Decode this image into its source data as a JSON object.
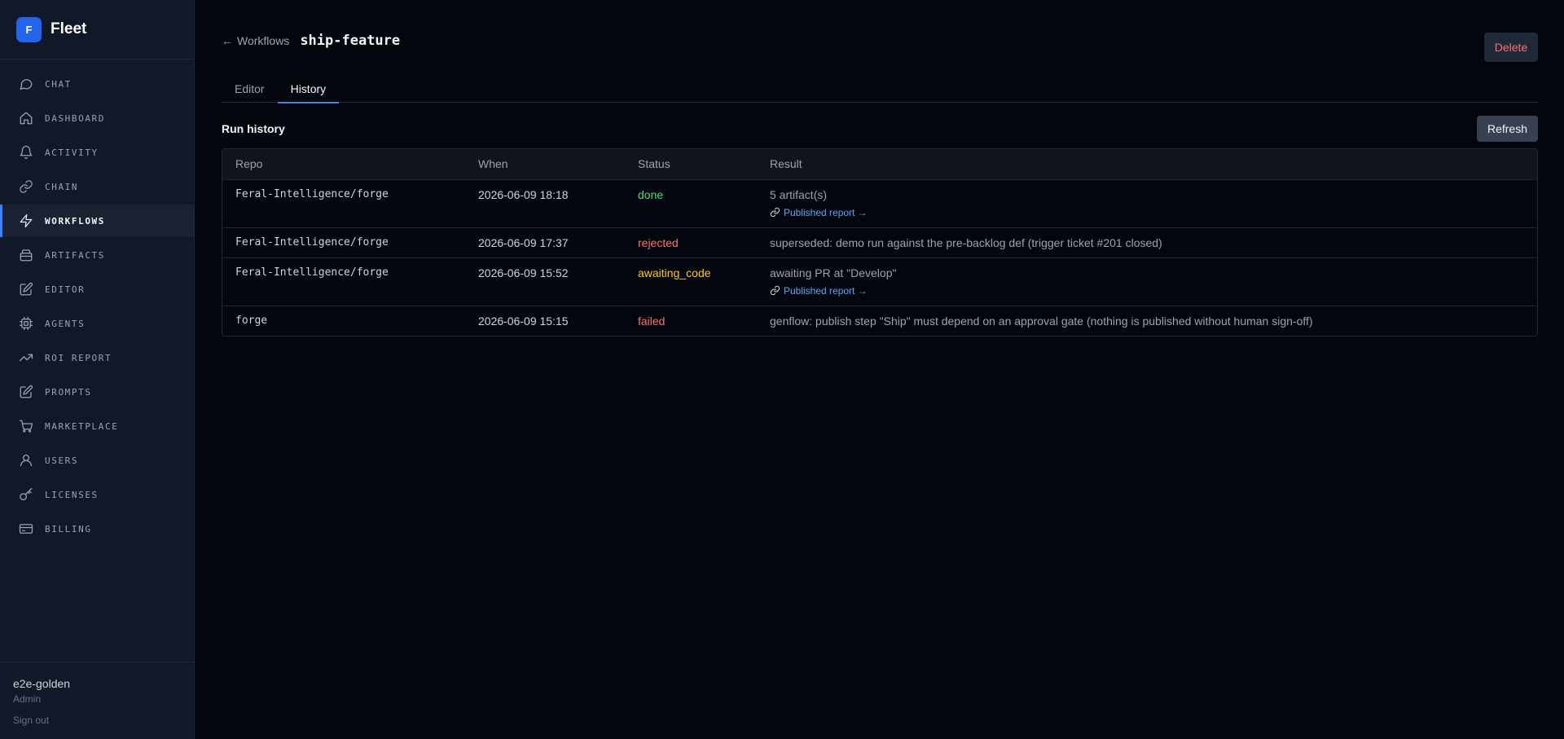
{
  "brand": {
    "logo_letter": "F",
    "name": "Fleet",
    "accent": "#2563eb"
  },
  "sidebar": {
    "items": [
      {
        "label": "CHAT",
        "icon": "chat-icon"
      },
      {
        "label": "DASHBOARD",
        "icon": "home-icon"
      },
      {
        "label": "ACTIVITY",
        "icon": "bell-icon"
      },
      {
        "label": "CHAIN",
        "icon": "link-icon"
      },
      {
        "label": "WORKFLOWS",
        "icon": "bolt-icon",
        "active": true
      },
      {
        "label": "ARTIFACTS",
        "icon": "box-icon"
      },
      {
        "label": "EDITOR",
        "icon": "edit-icon"
      },
      {
        "label": "AGENTS",
        "icon": "agent-icon"
      },
      {
        "label": "ROI REPORT",
        "icon": "trend-icon"
      },
      {
        "label": "PROMPTS",
        "icon": "prompt-icon"
      },
      {
        "label": "MARKETPLACE",
        "icon": "cart-icon"
      },
      {
        "label": "USERS",
        "icon": "user-icon"
      },
      {
        "label": "LICENSES",
        "icon": "key-icon"
      },
      {
        "label": "BILLING",
        "icon": "card-icon"
      }
    ]
  },
  "user": {
    "name": "e2e-golden",
    "role": "Admin",
    "signout": "Sign out"
  },
  "header": {
    "back_arrow": "←",
    "back_label": "Workflows",
    "title": "ship-feature",
    "delete_label": "Delete"
  },
  "tabs": [
    {
      "label": "Editor",
      "active": false
    },
    {
      "label": "History",
      "active": true
    }
  ],
  "history": {
    "title": "Run history",
    "refresh_label": "Refresh",
    "columns": [
      "Repo",
      "When",
      "Status",
      "Result"
    ],
    "rows": [
      {
        "repo": "Feral-Intelligence/forge",
        "when": "2026-06-09 18:18",
        "status": "done",
        "result": "5 artifact(s)",
        "link": "Published report →"
      },
      {
        "repo": "Feral-Intelligence/forge",
        "when": "2026-06-09 17:37",
        "status": "rejected",
        "result": "superseded: demo run against the pre-backlog def (trigger ticket #201 closed)",
        "link": ""
      },
      {
        "repo": "Feral-Intelligence/forge",
        "when": "2026-06-09 15:52",
        "status": "awaiting_code",
        "result": "awaiting PR at \"Develop\"",
        "link": "Published report →"
      },
      {
        "repo": "forge",
        "when": "2026-06-09 15:15",
        "status": "failed",
        "result": "genflow: publish step \"Ship\" must depend on an approval gate (nothing is published without human sign-off)",
        "link": ""
      }
    ]
  },
  "colors": {
    "done": "#4ade80",
    "rejected": "#f87171",
    "awaiting_code": "#facc15",
    "failed": "#f87171",
    "link": "#60a5fa"
  }
}
